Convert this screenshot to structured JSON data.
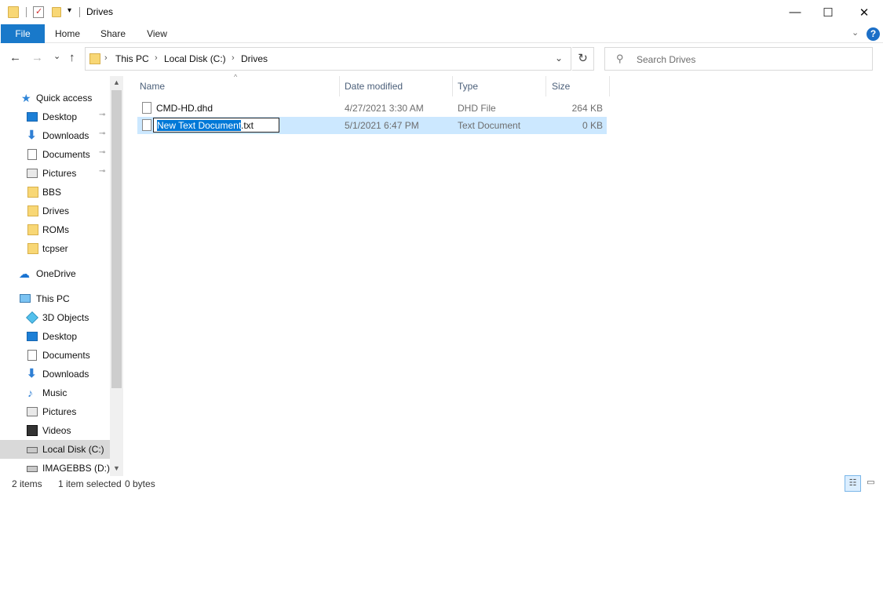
{
  "window": {
    "title": "Drives",
    "minimize_glyph": "—",
    "maximize_glyph": "☐",
    "close_glyph": "✕",
    "qat_dropdown_glyph": "▾"
  },
  "ribbon": {
    "tabs": [
      "File",
      "Home",
      "Share",
      "View"
    ],
    "expand_glyph": "⌄",
    "help_glyph": "?"
  },
  "nav": {
    "back_glyph": "←",
    "forward_glyph": "→",
    "recent_glyph": "⌄",
    "up_glyph": "↑",
    "refresh_glyph": "↻",
    "dropdown_glyph": "⌄"
  },
  "address": {
    "sep": "›",
    "crumbs": [
      "This PC",
      "Local Disk (C:)",
      "Drives"
    ]
  },
  "search": {
    "placeholder": "Search Drives",
    "icon": "search-icon"
  },
  "navpane": {
    "pin_glyph": "📌",
    "items": [
      {
        "label": "Quick access",
        "icon": "star-icon"
      },
      {
        "label": "Desktop",
        "icon": "desktop-icon",
        "pinned": true
      },
      {
        "label": "Downloads",
        "icon": "download-icon",
        "pinned": true
      },
      {
        "label": "Documents",
        "icon": "documents-icon",
        "pinned": true
      },
      {
        "label": "Pictures",
        "icon": "pictures-icon",
        "pinned": true
      },
      {
        "label": "BBS",
        "icon": "folder-icon"
      },
      {
        "label": "Drives",
        "icon": "folder-icon"
      },
      {
        "label": "ROMs",
        "icon": "folder-icon"
      },
      {
        "label": "tcpser",
        "icon": "folder-icon"
      },
      {
        "label": "OneDrive",
        "icon": "cloud-icon"
      },
      {
        "label": "This PC",
        "icon": "computer-icon"
      },
      {
        "label": "3D Objects",
        "icon": "cube-icon"
      },
      {
        "label": "Desktop",
        "icon": "desktop-icon"
      },
      {
        "label": "Documents",
        "icon": "documents-icon"
      },
      {
        "label": "Downloads",
        "icon": "download-icon"
      },
      {
        "label": "Music",
        "icon": "music-icon"
      },
      {
        "label": "Pictures",
        "icon": "pictures-icon"
      },
      {
        "label": "Videos",
        "icon": "video-icon"
      },
      {
        "label": "Local Disk (C:)",
        "icon": "drive-icon",
        "selected": true
      },
      {
        "label": "IMAGEBBS (D:)",
        "icon": "drive-icon"
      }
    ]
  },
  "filelist": {
    "sort_glyph": "^",
    "columns": [
      "Name",
      "Date modified",
      "Type",
      "Size"
    ],
    "rows": [
      {
        "name": "CMD-HD.dhd",
        "date": "4/27/2021 3:30 AM",
        "type": "DHD File",
        "size": "264 KB"
      },
      {
        "name": "New Text Document.txt",
        "date": "5/1/2021 6:47 PM",
        "type": "Text Document",
        "size": "0 KB",
        "rename_selected": "New Text Document",
        "rename_rest": ".txt"
      }
    ]
  },
  "status": {
    "count": "2 items",
    "selection": "1 item selected",
    "size": "0 bytes"
  },
  "scroll": {
    "up_glyph": "▲",
    "down_glyph": "▼"
  },
  "views": {
    "details_glyph": "☷",
    "tiles_glyph": "▭"
  }
}
